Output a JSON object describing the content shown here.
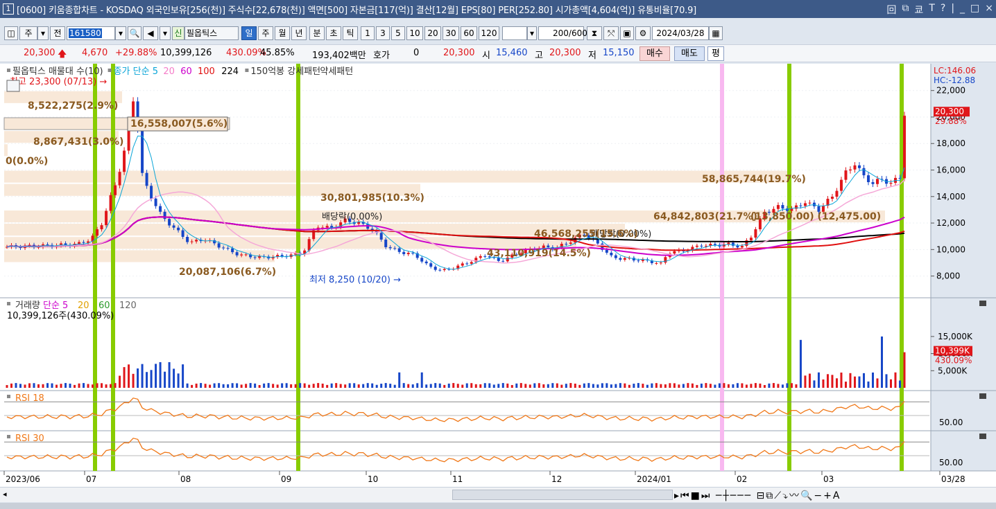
{
  "window": {
    "index": "1",
    "title": "[0600] 키움종합차트 - KOSDAQ 외국인보유[256(천)] 주식수[22,678(천)] 액면[500] 자본금[117(억)] 결산[12월] EPS[80] PER[252.80] 시가총액[4,604(억)] 유통비율[70.9]",
    "buttons": [
      "回",
      "⧉",
      "쿄",
      "T",
      "?",
      "|",
      "_",
      "□",
      "×"
    ]
  },
  "toolbar": {
    "market": "주",
    "prev": "전",
    "code": "161580",
    "search_icon": "🔍",
    "sound_icon": "◀",
    "badge_new": "신",
    "stock_name": "필옵틱스",
    "periods": [
      "일",
      "주",
      "월",
      "년",
      "분",
      "초",
      "틱"
    ],
    "selected_period": "일",
    "ticks": [
      "1",
      "3",
      "5",
      "10",
      "20",
      "30",
      "60",
      "120"
    ],
    "count": "200",
    "count_total": "/600",
    "date": "2024/03/28"
  },
  "ticker": {
    "price": "20,300",
    "change": "4,670",
    "change_pct": "+29.88%",
    "volume": "10,399,126",
    "vol_ratio": "430.09%",
    "turnover": "45.85%",
    "amount": "193,402백만",
    "hoga_label": "호가",
    "hoga_value": "0",
    "cur": "20,300",
    "open_label": "시",
    "open": "15,460",
    "high_label": "고",
    "high": "20,300",
    "low_label": "저",
    "low": "15,150",
    "buy": "매수",
    "sell": "매도",
    "avg": "평"
  },
  "chart_data": {
    "type": "candlestick",
    "price_panel": {
      "legend": [
        "필옵틱스 매물대 수(10)",
        "종가 단순 5",
        "20",
        "60",
        "100",
        "224",
        "150억봉 강세패턴",
        "약세패턴"
      ],
      "legend_colors": [
        "#333333",
        "#0aa5d8",
        "#f57cc8",
        "#cc00cc",
        "#e01010",
        "#000000",
        "#333333",
        "#333333"
      ],
      "lc": "LC:146.06",
      "hc": "HC:-12.88",
      "yticks": [
        "22,000",
        "20,000",
        "18,000",
        "16,000",
        "14,000",
        "12,000",
        "10,000",
        "8,000"
      ],
      "ytick_values": [
        22000,
        20000,
        18000,
        16000,
        14000,
        12000,
        10000,
        8000
      ],
      "current_label": "20,300",
      "current_pct": "29.88%",
      "high_marker": "최고 23,300 (07/13)",
      "low_marker": "최저 8,250 (10/20)",
      "ex_dividend_1": "배당락(0.00%)",
      "ex_dividend_2": "배당락(0.00%)",
      "volume_profile": [
        {
          "label": "8,522,275(2.9%)",
          "low": 21000,
          "high": 22000
        },
        {
          "label": "16,558,007(5.6%)",
          "low": 19000,
          "high": 20000
        },
        {
          "label": "8,867,431(3.0%)",
          "low": 18000,
          "high": 19000
        },
        {
          "label": "0(0.0%)",
          "low": 17000,
          "high": 18000
        },
        {
          "label": "58,865,744(19.7%)",
          "low": 15000,
          "high": 16000
        },
        {
          "label": "30,801,985(10.3%)",
          "low": 14000,
          "high": 15000
        },
        {
          "label": "64,842,803(21.7%)",
          "low": 12000,
          "high": 13000
        },
        {
          "label": "46,568,255(15.6%)",
          "low": 11000,
          "high": 12000
        },
        {
          "label": "43,110,919(14.5%)",
          "low": 10000,
          "high": 11000
        },
        {
          "label": "20,087,106(6.7%)",
          "low": 9000,
          "high": 10000
        }
      ],
      "annotation_extra": "(13,850.00) (12,475.00)"
    },
    "volume_panel": {
      "legend": [
        "거래량",
        "단순 5",
        "20",
        "60",
        "120"
      ],
      "legend_colors": [
        "#333333",
        "#cc00cc",
        "#e0a000",
        "#2a9a2a",
        "#666666"
      ],
      "last_volume": "10,399,126주(430.09%)",
      "yticks": [
        "15,000K",
        "10,000K",
        "5,000K"
      ],
      "current_label": "10,399K",
      "current_pct": "430.09%"
    },
    "rsi18": {
      "label": "RSI 18",
      "ytick": "50.00"
    },
    "rsi30": {
      "label": "RSI 30",
      "ytick": "50.00"
    },
    "xticks": [
      "2023/06",
      "07",
      "08",
      "09",
      "10",
      "11",
      "12",
      "2024/01",
      "02",
      "03",
      "03/28"
    ],
    "colors": {
      "up": "#e0161a",
      "down": "#1646c8",
      "green_marker": "#88cc00",
      "pink_marker": "#f8b8f0",
      "profile": "#f8e8d8"
    }
  }
}
